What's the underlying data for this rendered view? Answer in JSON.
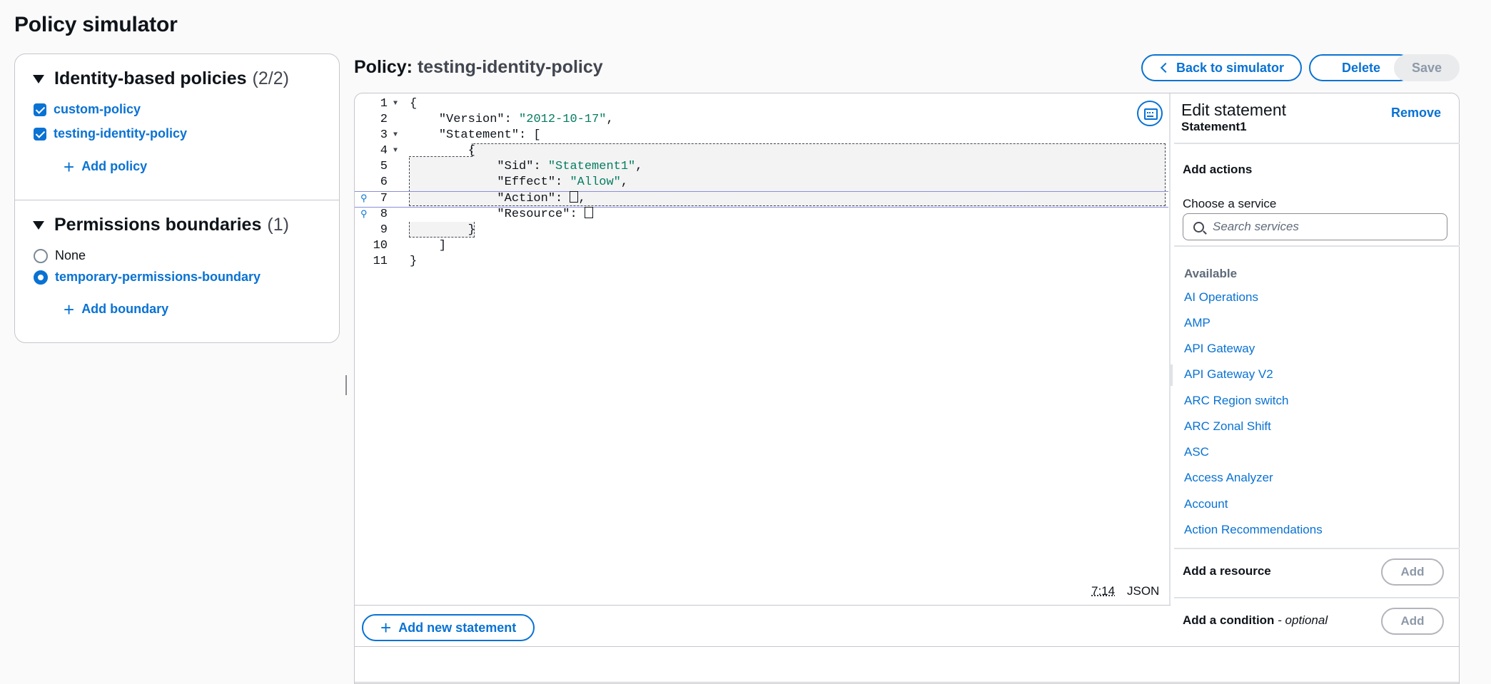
{
  "page": {
    "title": "Policy simulator"
  },
  "identity_policies": {
    "title": "Identity-based policies",
    "count": "(2/2)",
    "items": [
      {
        "label": "custom-policy",
        "checked": true
      },
      {
        "label": "testing-identity-policy",
        "checked": true
      }
    ],
    "add_label": "Add policy"
  },
  "boundaries": {
    "title": "Permissions boundaries",
    "count": "(1)",
    "options": [
      {
        "label": "None",
        "selected": false
      },
      {
        "label": "temporary-permissions-boundary",
        "selected": true
      }
    ],
    "add_label": "Add boundary"
  },
  "policy": {
    "prefix": "Policy:",
    "name": "testing-identity-policy",
    "back_label": "Back to simulator",
    "delete_label": "Delete",
    "save_label": "Save"
  },
  "editor": {
    "lines": [
      {
        "n": "1",
        "fold": true
      },
      {
        "n": "2"
      },
      {
        "n": "3",
        "fold": true
      },
      {
        "n": "4",
        "fold": true
      },
      {
        "n": "5"
      },
      {
        "n": "6"
      },
      {
        "n": "7",
        "hint": true
      },
      {
        "n": "8",
        "hint": true
      },
      {
        "n": "9"
      },
      {
        "n": "10"
      },
      {
        "n": "11"
      }
    ],
    "code": {
      "l1": "{",
      "l2_key": "\"Version\"",
      "l2_val": "\"2012-10-17\"",
      "l3_key": "\"Statement\"",
      "l3_rest": ": [",
      "l4": "{",
      "l5_key": "\"Sid\"",
      "l5_val": "\"Statement1\"",
      "l6_key": "\"Effect\"",
      "l6_val": "\"Allow\"",
      "l7_key": "\"Action\"",
      "l8_key": "\"Resource\"",
      "l9": "}",
      "l10": "]",
      "l11": "}"
    },
    "cursor_position": "7:14",
    "language": "JSON",
    "add_statement_label": "Add new statement"
  },
  "side_panel": {
    "title": "Edit statement",
    "statement_id": "Statement1",
    "remove_label": "Remove",
    "add_actions_label": "Add actions",
    "choose_service_label": "Choose a service",
    "search_placeholder": "Search services",
    "available_label": "Available",
    "services": [
      "AI Operations",
      "AMP",
      "API Gateway",
      "API Gateway V2",
      "ARC Region switch",
      "ARC Zonal Shift",
      "ASC",
      "Access Analyzer",
      "Account",
      "Action Recommendations"
    ],
    "add_resource_label": "Add a resource",
    "add_condition_label": "Add a condition",
    "add_condition_optional": "- optional",
    "add_button_label": "Add"
  },
  "colors": {
    "link": "#0972d3",
    "string": "#067d62",
    "text": "#0f141a"
  }
}
